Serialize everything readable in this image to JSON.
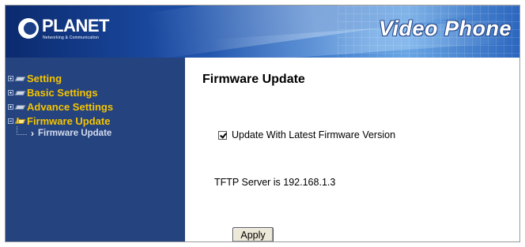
{
  "header": {
    "logo_text": "PLANET",
    "logo_tagline": "Networking & Communication",
    "product_name": "Video Phone"
  },
  "sidebar": {
    "items": [
      {
        "label": "Setting",
        "expanded": false
      },
      {
        "label": "Basic Settings",
        "expanded": false
      },
      {
        "label": "Advance Settings",
        "expanded": false
      },
      {
        "label": "Firmware Update",
        "expanded": true
      }
    ],
    "child": {
      "label": "Firmware Update",
      "arrow": "›"
    }
  },
  "main": {
    "title": "Firmware Update",
    "checkbox_label": "Update With Latest Firmware Version",
    "checkbox_checked": true,
    "tftp_text": "TFTP Server is 192.168.1.3",
    "apply_label": "Apply"
  },
  "colors": {
    "sidebar_bg": "#25437e",
    "menu_text": "#f5c400",
    "child_text": "#d4dcf0"
  }
}
